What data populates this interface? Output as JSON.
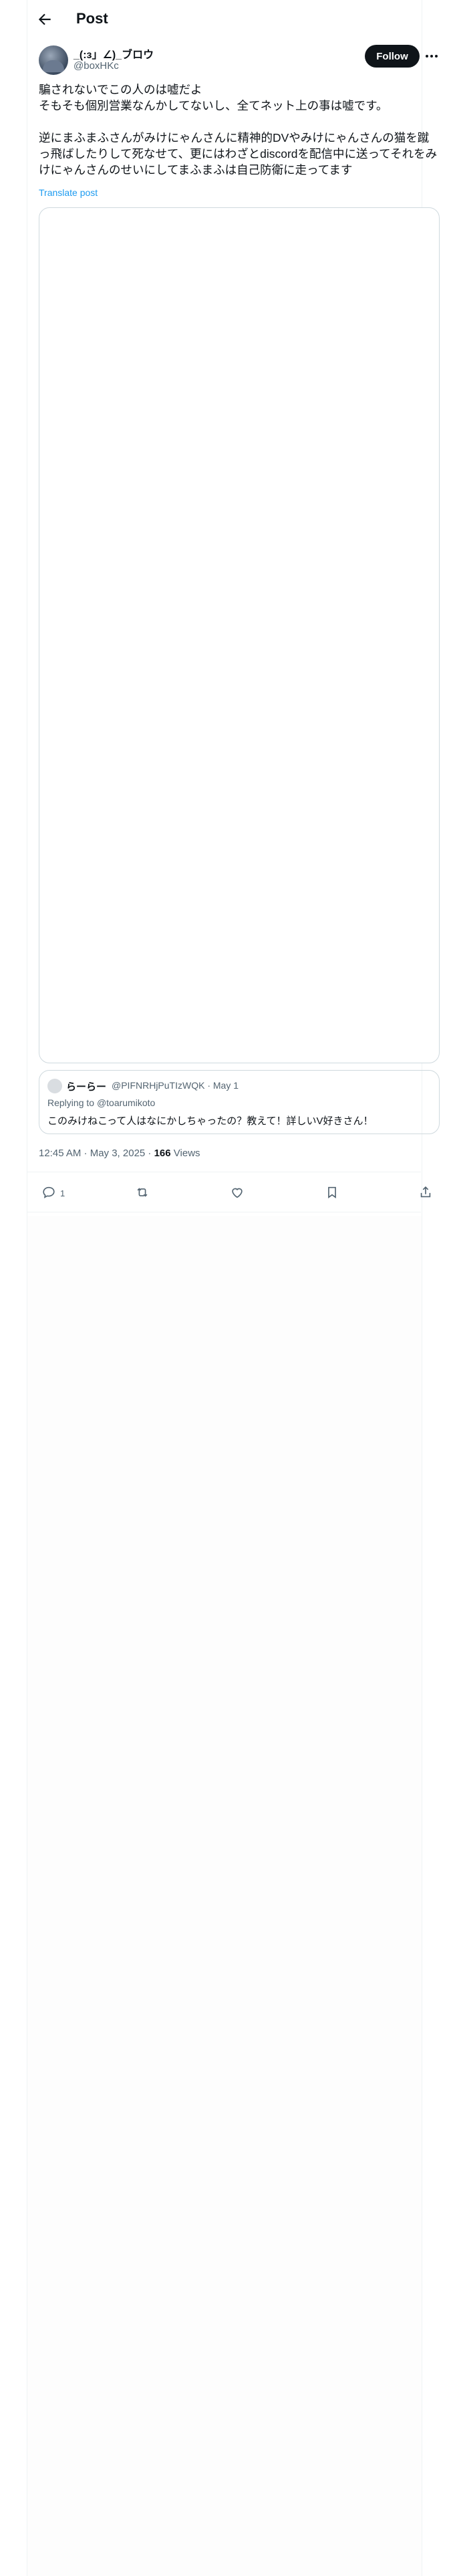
{
  "header": {
    "title": "Post"
  },
  "author": {
    "name": "_(:з」∠)_ブロウ",
    "handle": "@boxHKc"
  },
  "follow_label": "Follow",
  "tweet": {
    "text": "騙されないでこの人のは嘘だよ\nそもそも個別営業なんかしてないし、全てネット上の事は嘘です。\n\n逆にまふまふさんがみけにゃんさんに精神的DVやみけにゃんさんの猫を蹴っ飛ばしたりして死なせて、更にはわざとdiscordを配信中に送ってそれをみけにゃんさんのせいにしてまふまふは自己防衛に走ってます",
    "translate": "Translate post"
  },
  "quote": {
    "name": "らーらー",
    "handle": "@PIFNRHjPuTIzWQK · May 1",
    "replying_prefix": "Replying to ",
    "replying_to": "@toarumikoto",
    "text": "このみけねこって人はなにかしちゃったの？教えて！詳しいV好きさん！"
  },
  "meta": {
    "time": "12:45 AM · May 3, 2025 · ",
    "views_count": "166",
    "views_label": " Views"
  },
  "actions": {
    "reply_count": "1"
  }
}
